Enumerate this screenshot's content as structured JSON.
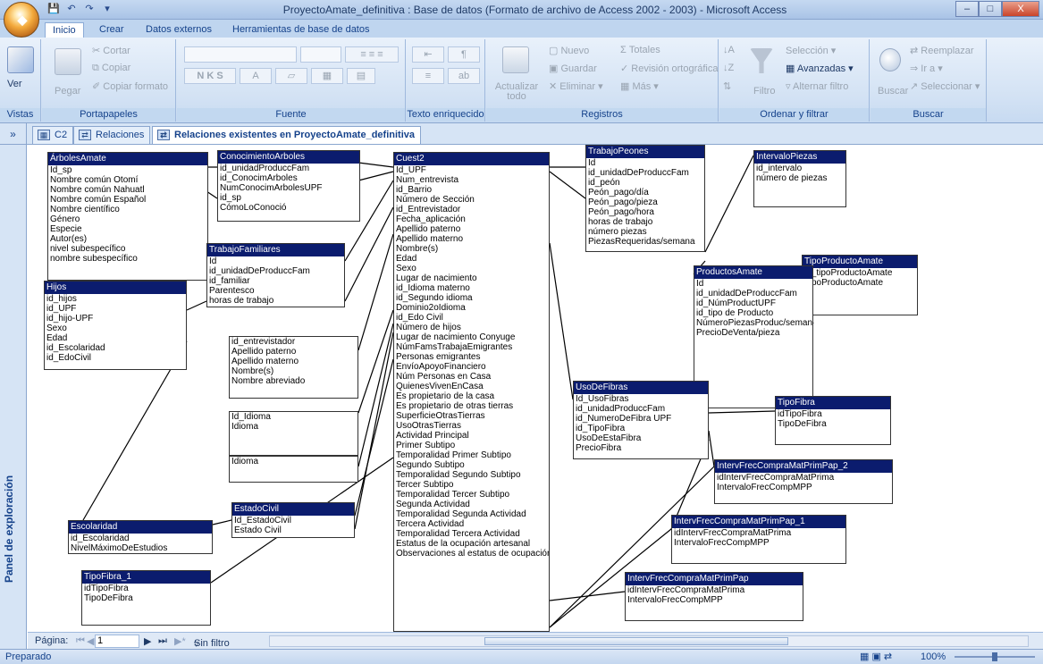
{
  "window": {
    "title": "ProyectoAmate_definitiva : Base de datos (Formato de archivo de Access 2002 - 2003) - Microsoft Access"
  },
  "ribbon_tabs": [
    "Inicio",
    "Crear",
    "Datos externos",
    "Herramientas de base de datos"
  ],
  "ribbon": {
    "vistas": {
      "ver": "Ver",
      "label": "Vistas"
    },
    "portapapeles": {
      "pegar": "Pegar",
      "cortar": "Cortar",
      "copiar": "Copiar",
      "copiar_formato": "Copiar formato",
      "label": "Portapapeles"
    },
    "fuente": {
      "label": "Fuente"
    },
    "texto": {
      "label": "Texto enriquecido"
    },
    "registros": {
      "actualizar": "Actualizar todo",
      "nuevo": "Nuevo",
      "guardar": "Guardar",
      "eliminar": "Eliminar",
      "totales": "Totales",
      "revision": "Revisión ortográfica",
      "mas": "Más",
      "label": "Registros"
    },
    "ordenar": {
      "filtro": "Filtro",
      "seleccion": "Selección",
      "avanzadas": "Avanzadas",
      "alternar": "Alternar filtro",
      "label": "Ordenar y filtrar"
    },
    "buscar": {
      "buscar": "Buscar",
      "reemplazar": "Reemplazar",
      "ira": "Ir a",
      "seleccionar": "Seleccionar",
      "label": "Buscar"
    }
  },
  "doc_tabs": [
    {
      "label": "C2",
      "icon": "table-icon"
    },
    {
      "label": "Relaciones",
      "icon": "relationships-icon"
    },
    {
      "label": "Relaciones existentes en ProyectoAmate_definitiva",
      "icon": "relationships-icon"
    }
  ],
  "nav_pane": {
    "label": "Panel de exploración"
  },
  "tables": {
    "arboles": {
      "name": "ÁrbolesAmate",
      "fields": [
        "Id_sp",
        "Nombre común Otomí",
        "Nombre común Nahuatl",
        "Nombre común Español",
        "Nombre científico",
        "Género",
        "Especie",
        "Autor(es)",
        "nivel subespecífico",
        "nombre subespecífico"
      ]
    },
    "conocimiento": {
      "name": "ConocimientoArboles",
      "fields": [
        "id_unidadProduccFam",
        "id_ConocimArboles",
        "NumConocimArbolesUPF",
        "id_sp",
        "CómoLoConoció"
      ]
    },
    "trabajofam": {
      "name": "TrabajoFamiliares",
      "fields": [
        "Id",
        "id_unidadDeProduccFam",
        "id_familiar",
        "Parentesco",
        "horas de trabajo"
      ]
    },
    "hijos": {
      "name": "Hijos",
      "fields": [
        "id_hijos",
        "id_UPF",
        "id_hijo-UPF",
        "Sexo",
        "Edad",
        "id_Escolaridad",
        "id_EdoCivil"
      ]
    },
    "entrevistador": {
      "name": "",
      "fields": [
        "id_entrevistador",
        "Apellido paterno",
        "Apellido materno",
        "Nombre(s)",
        "Nombre abreviado"
      ]
    },
    "idioma": {
      "name": "",
      "fields": [
        "Id_Idioma",
        "Idioma"
      ]
    },
    "idioma2": {
      "name": "",
      "fields": [
        "Idioma"
      ]
    },
    "estadocivil": {
      "name": "EstadoCivil",
      "fields": [
        "Id_EstadoCivil",
        "Estado Civil"
      ]
    },
    "escolaridad": {
      "name": "Escolaridad",
      "fields": [
        "id_Escolaridad",
        "NivelMáximoDeEstudios"
      ]
    },
    "tipofibra1": {
      "name": "TipoFibra_1",
      "fields": [
        "idTipoFibra",
        "TipoDeFibra"
      ]
    },
    "cuest2": {
      "name": "Cuest2",
      "fields": [
        "Id_UPF",
        "Num_entrevista",
        "id_Barrio",
        "Número de Sección",
        "id_Entrevistador",
        "Fecha_aplicación",
        "Apellido paterno",
        "Apellido materno",
        "Nombre(s)",
        "Edad",
        "Sexo",
        "Lugar de nacimiento",
        "id_Idioma materno",
        "id_Segundo idioma",
        "Dominio2oIdioma",
        "id_Edo Civil",
        "Número de hijos",
        "Lugar de nacimiento Conyuge",
        "NúmFamsTrabajaEmigrantes",
        "Personas emigrantes",
        "EnvíoApoyoFinanciero",
        "Núm Personas en Casa",
        "QuienesVivenEnCasa",
        "Es propietario de la casa",
        "Es propietario de otras tierras",
        "SuperficieOtrasTierras",
        "UsoOtrasTierras",
        "Actividad Principal",
        "Primer Subtipo",
        "Temporalidad Primer Subtipo",
        "Segundo Subtipo",
        "Temporalidad Segundo Subtipo",
        "Tercer Subtipo",
        "Temporalidad Tercer Subtipo",
        "Segunda Actividad",
        "Temporalidad Segunda Actividad",
        "Tercera Actividad",
        "Temporalidad Tercera Actividad",
        "Estatus de la ocupación artesanal",
        "Observaciones al estatus de ocupación"
      ]
    },
    "trabajopeones": {
      "name": "TrabajoPeones",
      "fields": [
        "Id",
        "id_unidadDeProduccFam",
        "id_peón",
        "Peón_pago/día",
        "Peón_pago/pieza",
        "Peón_pago/hora",
        "horas de trabajo",
        "número piezas",
        "PiezasRequeridas/semana"
      ]
    },
    "intervalo": {
      "name": "IntervaloPiezas",
      "fields": [
        "id_intervalo",
        "número de piezas"
      ]
    },
    "tipoproducto": {
      "name": "TipoProductoAmate",
      "fields": [
        "id_tipoProductoAmate",
        "TipoProductoAmate"
      ]
    },
    "productos": {
      "name": "ProductosAmate",
      "fields": [
        "Id",
        "id_unidadDeProduccFam",
        "id_NúmProductUPF",
        "id_tipo de Producto",
        "NúmeroPiezasProduc/semana",
        "PrecioDeVenta/pieza"
      ]
    },
    "usofibras": {
      "name": "UsoDeFibras",
      "fields": [
        "Id_UsoFibras",
        "id_unidadProduccFam",
        "id_NumeroDeFibra UPF",
        "id_TipoFibra",
        "UsoDeEstaFibra",
        "PrecioFibra"
      ]
    },
    "tipofibra": {
      "name": "TipoFibra",
      "fields": [
        "idTipoFibra",
        "TipoDeFibra"
      ]
    },
    "ifc2": {
      "name": "IntervFrecCompraMatPrimPap_2",
      "fields": [
        "idIntervFrecCompraMatPrima",
        "IntervaloFrecCompMPP"
      ]
    },
    "ifc1": {
      "name": "IntervFrecCompraMatPrimPap_1",
      "fields": [
        "idIntervFrecCompraMatPrima",
        "IntervaloFrecCompMPP"
      ]
    },
    "ifc": {
      "name": "IntervFrecCompraMatPrimPap",
      "fields": [
        "idIntervFrecCompraMatPrima",
        "IntervaloFrecCompMPP"
      ]
    }
  },
  "bottom_nav": {
    "pagina": "Página:",
    "page_value": "1",
    "sin_filtro": "Sin filtro"
  },
  "status": {
    "text": "Preparado",
    "zoom": "100%"
  },
  "colors": {
    "table_header": "#0b1c6e",
    "ribbon": "#d3e2f4",
    "accent_text": "#15428b"
  }
}
